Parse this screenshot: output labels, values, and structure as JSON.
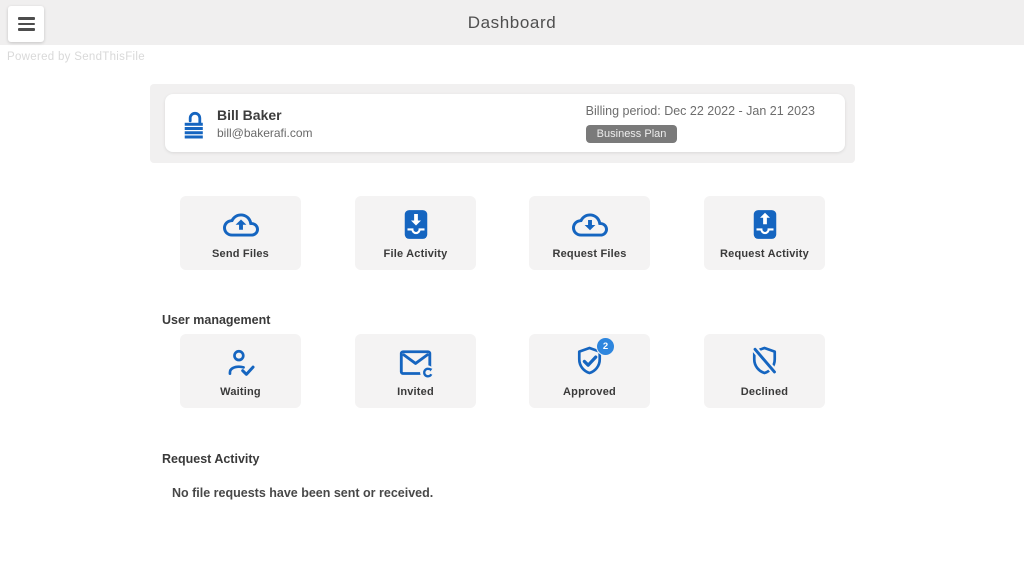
{
  "topbar": {
    "title": "Dashboard",
    "menu_icon": "hamburger-icon"
  },
  "powered_by": "Powered by SendThisFile",
  "account": {
    "lock_icon": "lock-icon",
    "name": "Bill Baker",
    "email": "bill@bakerafi.com",
    "billing_period": "Billing period: Dec 22 2022 - Jan 21 2023",
    "plan_badge": "Business Plan"
  },
  "quick_actions": {
    "tiles": [
      {
        "label": "Send Files",
        "icon": "cloud-upload-icon"
      },
      {
        "label": "File Activity",
        "icon": "inbox-download-icon"
      },
      {
        "label": "Request Files",
        "icon": "cloud-download-icon"
      },
      {
        "label": "Request Activity",
        "icon": "inbox-upload-icon"
      }
    ]
  },
  "user_management": {
    "heading": "User management",
    "tiles": [
      {
        "label": "Waiting",
        "icon": "person-check-icon"
      },
      {
        "label": "Invited",
        "icon": "mail-sync-icon"
      },
      {
        "label": "Approved",
        "icon": "shield-check-icon",
        "badge_count": "2"
      },
      {
        "label": "Declined",
        "icon": "shield-slash-icon"
      }
    ]
  },
  "request_activity": {
    "heading": "Request Activity",
    "empty_message": "No file requests have been sent or received."
  },
  "colors": {
    "accent_blue": "#1565c0",
    "badge_blue": "#2e86de",
    "topbar_gray": "#f0efef",
    "tile_gray": "#f4f3f3",
    "plan_badge_gray": "#7a7a7a"
  }
}
